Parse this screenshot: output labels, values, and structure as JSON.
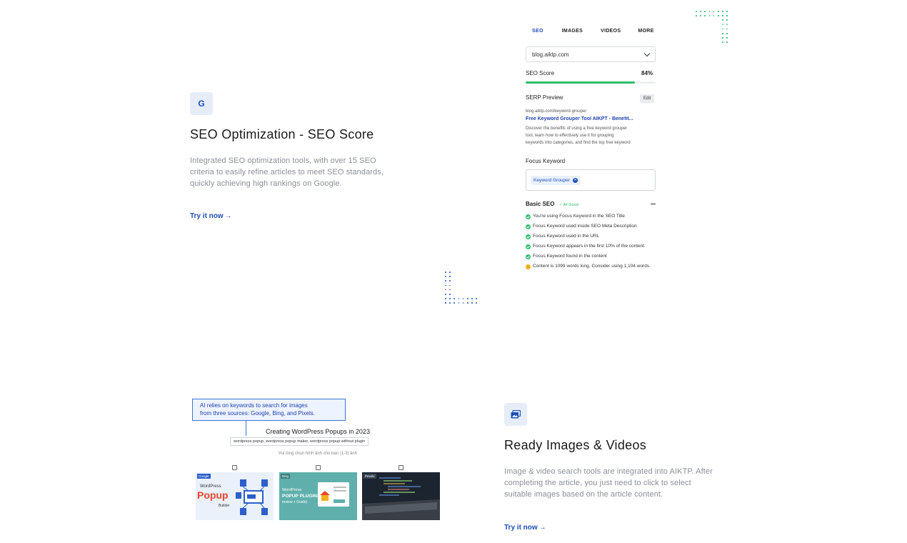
{
  "feature_seo": {
    "icon": "google-g-icon",
    "icon_glyph": "G",
    "title": "SEO Optimization - SEO Score",
    "description_lines": [
      "Integrated SEO optimization tools, with over 15 SEO",
      "criteria to easily refine articles to meet SEO standards,",
      "quickly achieving high rankings on Google."
    ],
    "cta": "Try it now"
  },
  "seo_panel": {
    "tabs": [
      "SEO",
      "IMAGES",
      "VIDEOS",
      "MORE"
    ],
    "active_tab": "SEO",
    "domain_select": "blog.aiktp.com",
    "seo_score_label": "SEO Score",
    "seo_score_value": "84%",
    "seo_score_fraction": 0.84,
    "serp_label": "SERP Preview",
    "edit_label": "Edit",
    "serp_url": "blog.aiktp.com/keyword-grouper",
    "serp_title": "Free Keyword Grouper Tool AIKPT - Benefit...",
    "serp_desc_lines": [
      "Discover the benefits of using a free keyword grouper",
      "tool, learn how to effectively use it for grouping",
      "keywords into categories, and find the top free keyword"
    ],
    "focus_label": "Focus Keyword",
    "focus_chip": "Keyword Grouper",
    "basic_seo_label": "Basic SEO",
    "all_good": "All Good",
    "checks": [
      {
        "text": "You're using Focus Keyword in the SEO Title",
        "status": "ok"
      },
      {
        "text": "Focus Keyword used inside SEO Meta Description",
        "status": "ok"
      },
      {
        "text": "Focus Keyword used in the URL",
        "status": "ok"
      },
      {
        "text": "Focus Keyword appears in the first 10% of the content",
        "status": "ok"
      },
      {
        "text": "Focus Keyword found in the content",
        "status": "ok"
      },
      {
        "text": "Content is 1099 words long. Consider using 1,104 words.",
        "status": "warn"
      }
    ]
  },
  "feature_images": {
    "icon": "image-gallery-icon",
    "title": "Ready Images & Videos",
    "description_lines": [
      "Image & video search tools are integrated into AIKTP. After",
      "completing the article, you just need to click to select",
      "suitable images based on the article content."
    ],
    "cta": "Try it now"
  },
  "image_art": {
    "callout_lines": [
      "AI relies on keywords to search for images",
      "from three sources: Google, Bing, and Pixels."
    ],
    "title": "Creating WordPress Popups in 2023",
    "keywords": "wordpress popup, wordpress popup maker, wordpress popup without plugin",
    "hint": "Vui lòng chọn hình ảnh cho bạn (1-3) ảnh",
    "sources": [
      "Google",
      "Bing",
      "Pexels"
    ],
    "thumb1_lines": [
      "WordPress",
      "Popup",
      "Builder"
    ],
    "thumb2_lines": [
      "WordPress",
      "POPUP PLUGINS",
      "review + Guide)"
    ]
  },
  "colors": {
    "accent": "#1d4fb8",
    "green": "#2ebd6f",
    "warn": "#f2b01e",
    "dots_blue": "#3b63c4",
    "dots_green": "#2ebd6f"
  }
}
